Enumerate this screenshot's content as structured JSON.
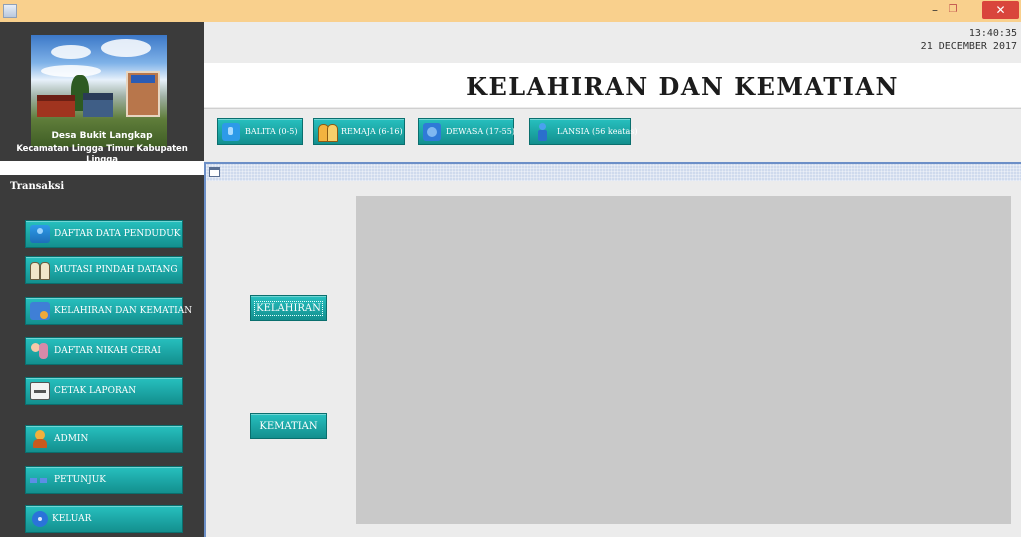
{
  "window": {
    "minimize_glyph": "–",
    "maximize_glyph": "❐",
    "close_glyph": "✕"
  },
  "sidebar": {
    "village_name": "Desa Bukit Langkap",
    "district": "Kecamatan Lingga Timur Kabupaten Lingga",
    "section_label": "Transaksi",
    "items": [
      {
        "label": "DAFTAR DATA PENDUDUK",
        "icon": "people-icon"
      },
      {
        "label": "MUTASI PINDAH DATANG",
        "icon": "pair-icon"
      },
      {
        "label": "KELAHIRAN DAN KEMATIAN",
        "icon": "family-icon"
      },
      {
        "label": "DAFTAR NIKAH CERAI",
        "icon": "couple-icon"
      },
      {
        "label": "CETAK LAPORAN",
        "icon": "printer-icon"
      },
      {
        "label": "ADMIN",
        "icon": "admin-icon"
      },
      {
        "label": "PETUNJUK",
        "icon": "help-icon"
      },
      {
        "label": "KELUAR",
        "icon": "exit-icon"
      }
    ]
  },
  "header": {
    "time": "13:40:35",
    "date": "21 DECEMBER 2017",
    "title": "KELAHIRAN DAN KEMATIAN"
  },
  "age_filters": [
    {
      "label": "BALITA (0-5)",
      "icon": "baby-icon"
    },
    {
      "label": "REMAJA (6-16)",
      "icon": "teen-icon"
    },
    {
      "label": "DEWASA (17-55)",
      "icon": "adult-icon"
    },
    {
      "label": "LANSIA (56 keatas)",
      "icon": "elder-icon"
    }
  ],
  "frame": {
    "actions": {
      "kelahiran": "KELAHIRAN",
      "kematian": "KEMATIAN"
    }
  },
  "colors": {
    "title_bar": "#f9d08d",
    "sidebar": "#3b3b3b",
    "button_teal": "#1aa8a7",
    "frame_border": "#6c8fc7",
    "content_panel": "#c9c9c9",
    "close_button": "#d9453c"
  }
}
